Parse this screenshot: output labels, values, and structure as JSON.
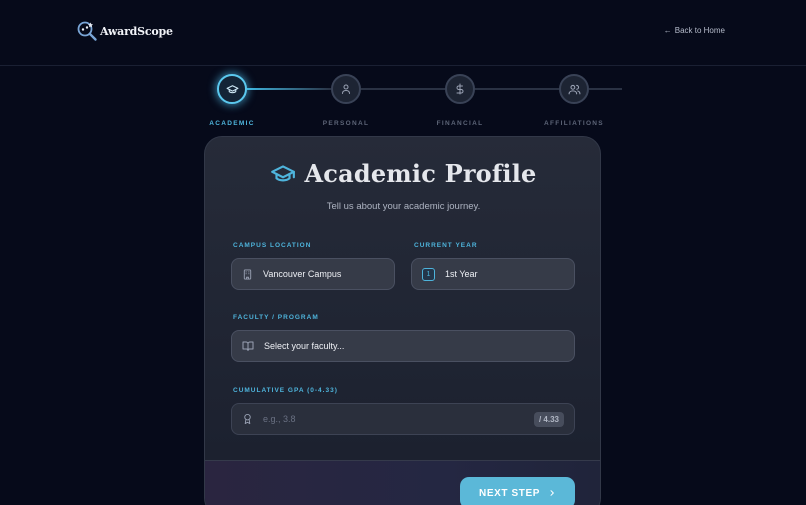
{
  "header": {
    "logo_text": "AwardScope",
    "back_link": "Back to Home"
  },
  "stepper": {
    "steps": [
      {
        "label": "ACADEMIC",
        "icon": "graduation-cap-icon",
        "active": true
      },
      {
        "label": "PERSONAL",
        "icon": "user-icon",
        "active": false
      },
      {
        "label": "FINANCIAL",
        "icon": "dollar-icon",
        "active": false
      },
      {
        "label": "AFFILIATIONS",
        "icon": "users-icon",
        "active": false
      }
    ]
  },
  "card": {
    "title": "Academic Profile",
    "subtitle": "Tell us about your academic journey.",
    "campus": {
      "label": "CAMPUS LOCATION",
      "value": "Vancouver Campus",
      "icon": "building-icon"
    },
    "year": {
      "label": "CURRENT YEAR",
      "value": "1st Year",
      "badge": "1"
    },
    "faculty": {
      "label": "FACULTY / PROGRAM",
      "value": "Select your faculty...",
      "icon": "book-icon"
    },
    "gpa": {
      "label": "CUMULATIVE GPA (0-4.33)",
      "placeholder": "e.g., 3.8",
      "suffix": "/ 4.33",
      "icon": "award-icon"
    },
    "next_button": "NEXT STEP"
  },
  "colors": {
    "accent": "#4eb4dc",
    "background": "#060a1a",
    "button": "#5bb8d8"
  }
}
